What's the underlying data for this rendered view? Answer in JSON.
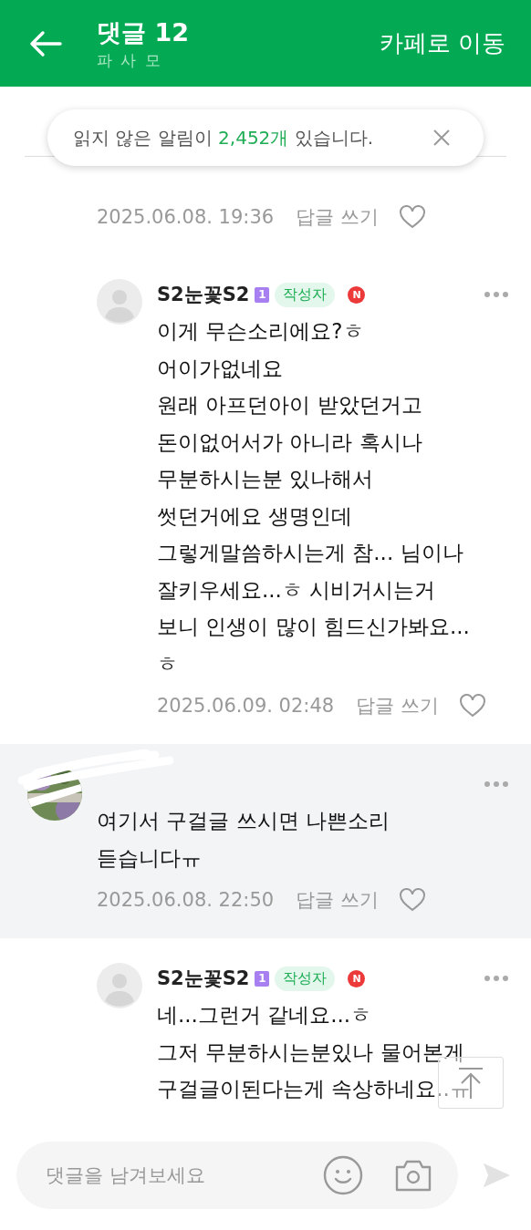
{
  "header": {
    "title": "댓글 12",
    "subtitle": "파 사 모",
    "action": "카페로 이동"
  },
  "toast": {
    "prefix": "읽지 않은 알림이",
    "count": "2,452개",
    "suffix": "있습니다."
  },
  "comments": [
    {
      "kind": "tail",
      "highlighted": false,
      "date": "2025.06.08. 19:36",
      "reply_label": "답글 쓰기",
      "liked": false
    },
    {
      "kind": "reply",
      "highlighted": false,
      "avatar": {
        "kind": "default"
      },
      "author": "S2눈꽃S2",
      "level": "1",
      "author_badge": "작성자",
      "new_badge": "N",
      "text": "이게 무슨소리에요?ㅎ\n어이가없네요\n원래 아프던아이 받았던거고\n돈이없어서가 아니라 혹시나\n무분하시는분 있나해서\n썻던거에요 생명인데\n그렇게말씀하시는게 참... 님이나\n잘키우세요...ㅎ 시비거시는거\n보니 인생이 많이 힘드신가봐요...\nㅎ",
      "date": "2025.06.09. 02:48",
      "reply_label": "답글 쓰기",
      "liked": false
    },
    {
      "kind": "comment",
      "highlighted": true,
      "text": "여기서 구걸글 쓰시면 나쁜소리\n듣습니다ㅠ",
      "date": "2025.06.08. 22:50",
      "reply_label": "답글 쓰기",
      "liked": false
    },
    {
      "kind": "reply",
      "highlighted": false,
      "avatar": {
        "kind": "default"
      },
      "author": "S2눈꽃S2",
      "level": "1",
      "author_badge": "작성자",
      "new_badge": "N",
      "text": "네...그런거 같네요...ㅎ\n그저 무분하시는분있나 물어본게\n구걸글이된다는게 속상하네요..ㅠ"
    }
  ],
  "composer": {
    "placeholder": "댓글을 남겨보세요"
  }
}
